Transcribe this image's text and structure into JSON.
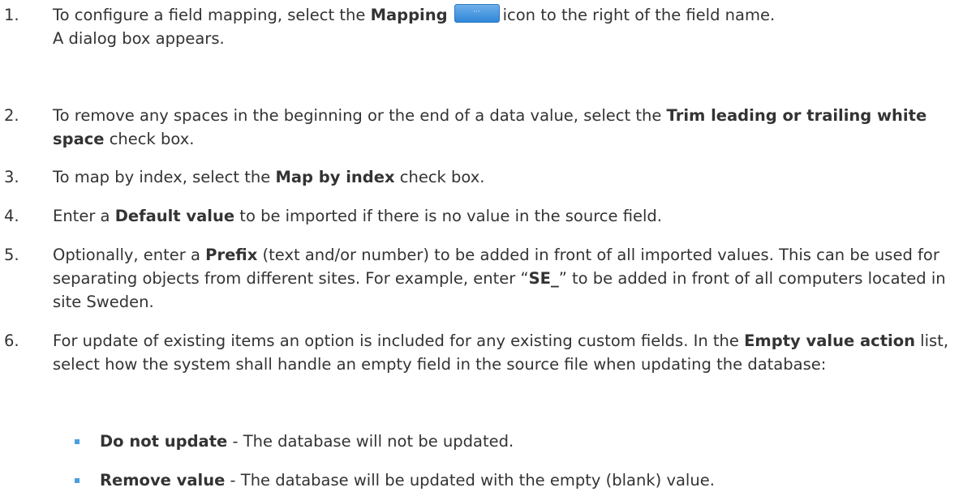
{
  "steps": [
    {
      "number": "1.",
      "pre": "To configure a field mapping, select the ",
      "bold": "Mapping",
      "icon": "more-dots-icon",
      "icon_glyph": "···",
      "post": "icon to the right of the field name.",
      "result": "A dialog box appears."
    },
    {
      "number": "2.",
      "pre": "To remove any spaces in the beginning or the end of a data value, select the ",
      "bold": "Trim leading or trailing white space",
      "post": " check box."
    },
    {
      "number": "3.",
      "pre": "To map by index, select the ",
      "bold": "Map by index",
      "post": " check box."
    },
    {
      "number": "4.",
      "pre": "Enter a ",
      "bold": "Default value",
      "post": " to be imported if there is no value in the source field."
    },
    {
      "number": "5.",
      "pre": "Optionally, enter a ",
      "bold": "Prefix",
      "mid": " (text and/or number) to be added in front of all imported values. This can be used for separating objects from different sites. For example, enter “",
      "bold2": "SE_",
      "post": "” to be added in front of all computers located in site Sweden."
    },
    {
      "number": "6.",
      "pre": "For update of existing items an option is included for any existing custom fields. In the ",
      "bold": "Empty value action",
      "post": " list, select how the system shall handle an empty field in the source file when updating the database:"
    }
  ],
  "bullets": [
    {
      "bold": "Do not update",
      "text": " - The database will not be updated."
    },
    {
      "bold": "Remove value",
      "text": " - The database will be updated with the empty (blank) value."
    }
  ],
  "colors": {
    "text": "#333333",
    "bullet": "#4a9fe0",
    "button": "#2f86d8"
  }
}
